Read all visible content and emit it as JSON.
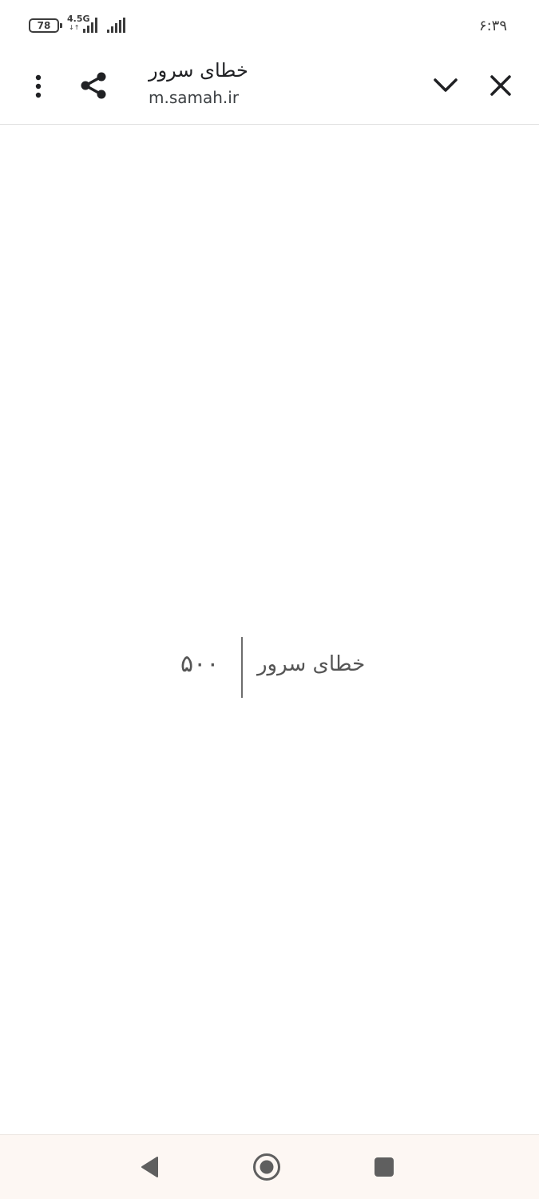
{
  "status_bar": {
    "battery_level": "78",
    "network_type": "4.5G",
    "network_arrows": "↓↑",
    "time": "۶:۳۹"
  },
  "toolbar": {
    "title": "خطای سرور",
    "url": "m.samah.ir",
    "icons": {
      "menu": "more-vert-icon",
      "share": "share-icon",
      "collapse": "chevron-down-icon",
      "close": "close-icon"
    }
  },
  "content": {
    "error_code": "۵۰۰",
    "error_message": "خطای سرور"
  },
  "nav_bar": {
    "icons": {
      "back": "back-triangle-icon",
      "home": "home-circle-icon",
      "recents": "recents-square-icon"
    }
  },
  "colors": {
    "text_primary": "#202124",
    "error_text": "#555555",
    "nav_background": "#fdf7f3"
  }
}
